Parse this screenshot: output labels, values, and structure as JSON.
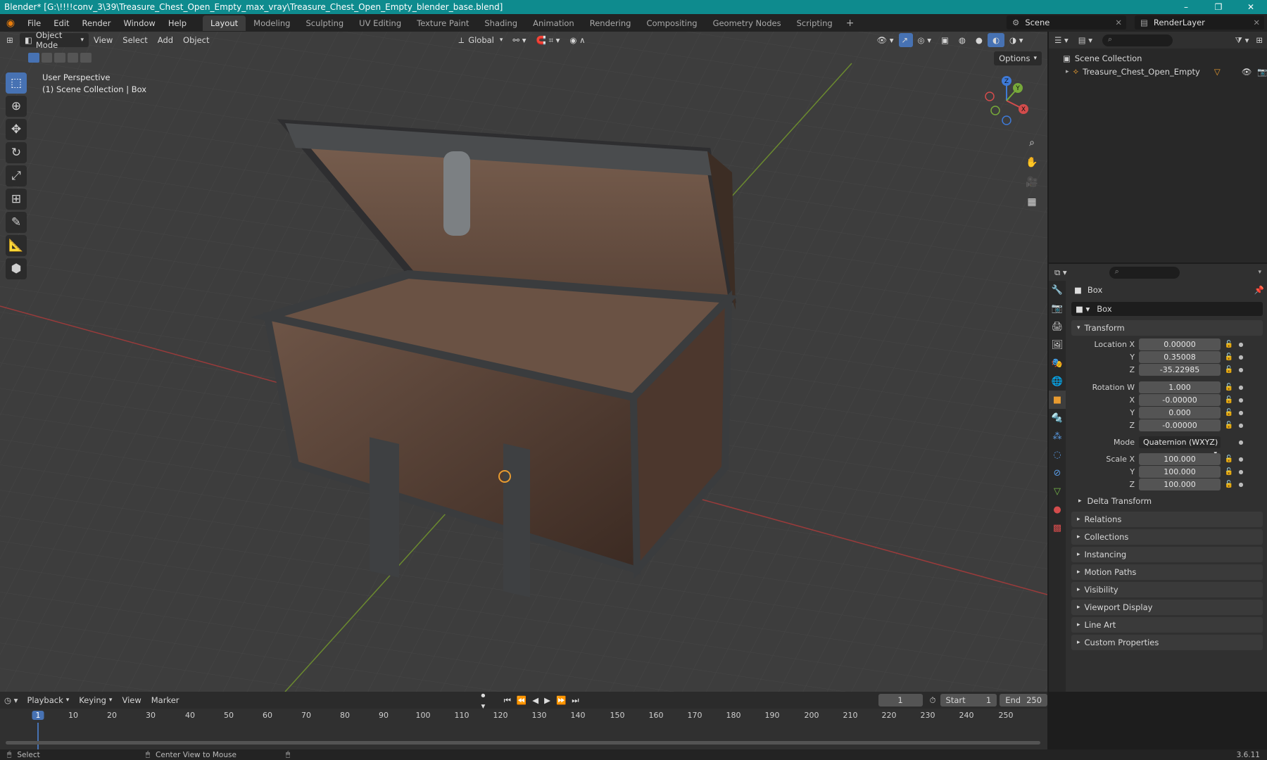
{
  "window": {
    "title": "Blender* [G:\\!!!!conv_3\\39\\Treasure_Chest_Open_Empty_max_vray\\Treasure_Chest_Open_Empty_blender_base.blend]",
    "controls": [
      "–",
      "❐",
      "✕"
    ]
  },
  "menu": [
    "File",
    "Edit",
    "Render",
    "Window",
    "Help"
  ],
  "workspaces": [
    "Layout",
    "Modeling",
    "Sculpting",
    "UV Editing",
    "Texture Paint",
    "Shading",
    "Animation",
    "Rendering",
    "Compositing",
    "Geometry Nodes",
    "Scripting"
  ],
  "active_workspace": "Layout",
  "scene": {
    "label": "Scene",
    "render_layer": "RenderLayer"
  },
  "viewport": {
    "mode": "Object Mode",
    "menus": [
      "View",
      "Select",
      "Add",
      "Object"
    ],
    "orientation": "Global",
    "options_label": "Options",
    "info_line1": "User Perspective",
    "info_line2": "(1) Scene Collection | Box",
    "gizmo": {
      "x": "X",
      "y": "Y",
      "z": "Z"
    }
  },
  "outliner": {
    "root": "Scene Collection",
    "items": [
      {
        "name": "Treasure_Chest_Open_Empty"
      }
    ]
  },
  "properties": {
    "object_name": "Box",
    "datablock": "Box",
    "transform_label": "Transform",
    "location_label": "Location X",
    "rotation_label": "Rotation W",
    "scale_label": "Scale X",
    "location": {
      "x": "0.00000",
      "y": "0.35008",
      "z": "-35.22985"
    },
    "rotation": {
      "w": "1.000",
      "x": "-0.00000",
      "y": "0.000",
      "z": "-0.00000"
    },
    "mode_label": "Mode",
    "mode_value": "Quaternion (WXYZ)",
    "scale": {
      "x": "100.000",
      "y": "100.000",
      "z": "100.000"
    },
    "axis": {
      "y": "Y",
      "z": "Z",
      "x": "X"
    },
    "delta_transform": "Delta Transform",
    "panels": [
      "Relations",
      "Collections",
      "Instancing",
      "Motion Paths",
      "Visibility",
      "Viewport Display",
      "Line Art",
      "Custom Properties"
    ]
  },
  "timeline": {
    "menus": [
      "Playback",
      "Keying",
      "View",
      "Marker"
    ],
    "current_frame": "1",
    "start_label": "Start",
    "start": "1",
    "end_label": "End",
    "end": "250",
    "ruler": [
      "1",
      "10",
      "20",
      "30",
      "40",
      "50",
      "60",
      "70",
      "80",
      "90",
      "100",
      "110",
      "120",
      "130",
      "140",
      "150",
      "160",
      "170",
      "180",
      "190",
      "200",
      "210",
      "220",
      "230",
      "240",
      "250"
    ]
  },
  "status": {
    "select": "Select",
    "center_view": "Center View to Mouse",
    "version": "3.6.11"
  }
}
